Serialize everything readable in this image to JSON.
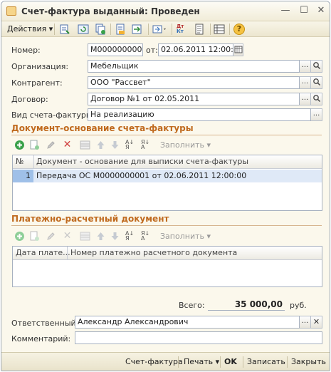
{
  "window": {
    "title": "Счет-фактура выданный: Проведен",
    "minimize": "—",
    "maximize": "☐",
    "close": "✕"
  },
  "toolbar": {
    "actions_label": "Действия",
    "dropdown_arrow": "▾",
    "icons": [
      "post-icon",
      "refresh-icon",
      "copy-doc-icon",
      "move-icon",
      "goto-icon",
      "dt-kt-icon",
      "print-icon",
      "structure-icon",
      "help-icon"
    ],
    "dt_kt": "Дт\nКт",
    "help": "?"
  },
  "form": {
    "number_label": "Номер:",
    "number_value": "М0000000001",
    "from_label": "от:",
    "date_value": "02.06.2011 12:00:00",
    "org_label": "Организация:",
    "org_value": "Мебельщик",
    "counterparty_label": "Контрагент:",
    "counterparty_value": "ООО \"Рассвет\"",
    "contract_label": "Договор:",
    "contract_value": "Договор №1 от 02.05.2011",
    "invoice_type_label": "Вид счета-фактуры:",
    "invoice_type_value": "На реализацию",
    "ellipsis": "...",
    "search_glyph": "⚲"
  },
  "base_section": {
    "title": "Документ-основание счета-фактуры",
    "fill_label": "Заполнить",
    "columns": [
      "№",
      "Документ - основание для выписки счета-фактуры"
    ],
    "rows": [
      {
        "num": "1",
        "document": "Передача ОС М0000000001 от 02.06.2011 12:00:00"
      }
    ]
  },
  "payment_section": {
    "title": "Платежно-расчетный документ",
    "fill_label": "Заполнить",
    "columns": [
      "Дата плате...",
      "Номер платежно расчетного документа"
    ],
    "rows": []
  },
  "totals": {
    "label": "Всего:",
    "value": "35 000,00",
    "currency": "руб."
  },
  "responsible": {
    "label": "Ответственный:",
    "value": "Александр Александрович",
    "clear": "✕"
  },
  "comment": {
    "label": "Комментарий:",
    "value": ""
  },
  "bottom_bar": {
    "invoice": "Счет-фактура",
    "print": "Печать",
    "ok": "OK",
    "save": "Записать",
    "close": "Закрыть"
  },
  "colors": {
    "section_title": "#c06a1e",
    "window_bg": "#fbf8ec",
    "selected_row": "#dfe9f7",
    "selected_num": "#9fc0e8"
  }
}
